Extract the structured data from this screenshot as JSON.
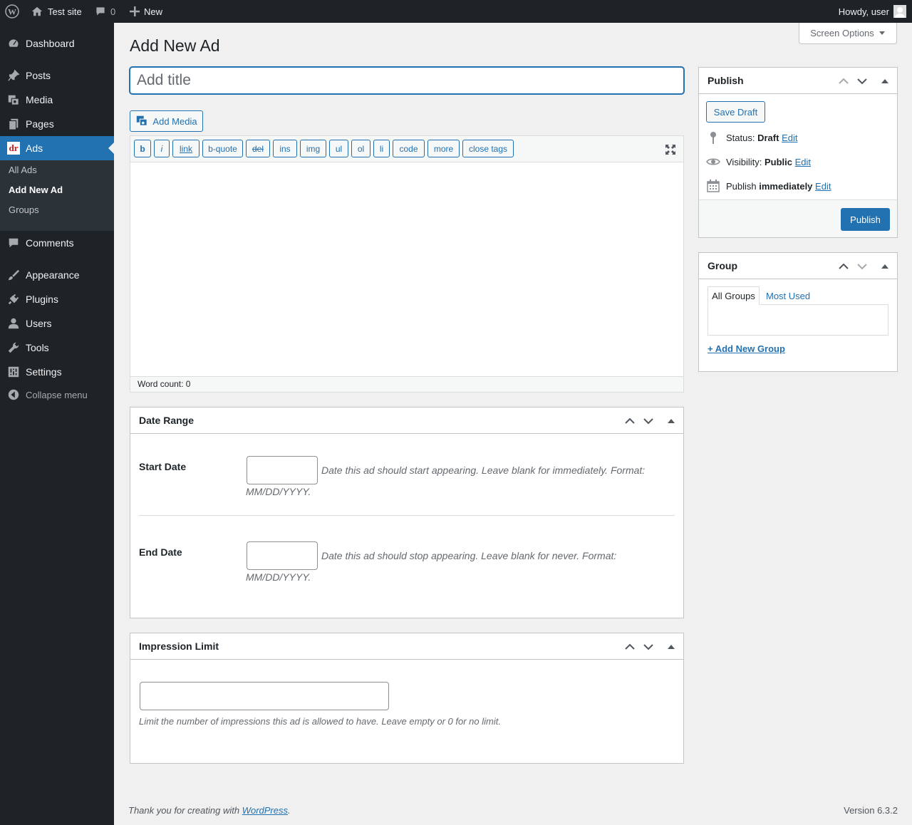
{
  "adminbar": {
    "site_name": "Test site",
    "comments_count": "0",
    "new_label": "New",
    "howdy": "Howdy, user"
  },
  "sidebar": {
    "items": [
      {
        "label": "Dashboard",
        "icon": "dashboard-icon"
      },
      {
        "label": "Posts",
        "icon": "pin-icon"
      },
      {
        "label": "Media",
        "icon": "media-icon"
      },
      {
        "label": "Pages",
        "icon": "pages-icon"
      },
      {
        "label": "Ads",
        "icon": "ads-logo-icon",
        "current": true
      },
      {
        "label": "Comments",
        "icon": "comment-icon"
      },
      {
        "label": "Appearance",
        "icon": "brush-icon"
      },
      {
        "label": "Plugins",
        "icon": "plug-icon"
      },
      {
        "label": "Users",
        "icon": "user-icon"
      },
      {
        "label": "Tools",
        "icon": "wrench-icon"
      },
      {
        "label": "Settings",
        "icon": "settings-icon"
      },
      {
        "label": "Collapse menu",
        "icon": "collapse-icon"
      }
    ],
    "submenu": [
      {
        "label": "All Ads"
      },
      {
        "label": "Add New Ad",
        "current": true
      },
      {
        "label": "Groups"
      }
    ],
    "ads_logo_text": "dr"
  },
  "page": {
    "title": "Add New Ad",
    "screen_options": "Screen Options",
    "title_placeholder": "Add title",
    "add_media": "Add Media"
  },
  "editor": {
    "quicktags": [
      "b",
      "i",
      "link",
      "b-quote",
      "del",
      "ins",
      "img",
      "ul",
      "ol",
      "li",
      "code",
      "more",
      "close tags"
    ],
    "word_count": "Word count: 0"
  },
  "date_range": {
    "title": "Date Range",
    "start_label": "Start Date",
    "start_value": "",
    "start_desc": "Date this ad should start appearing. Leave blank for immediately. Format: MM/DD/YYYY.",
    "end_label": "End Date",
    "end_value": "",
    "end_desc": "Date this ad should stop appearing. Leave blank for never. Format: MM/DD/YYYY."
  },
  "impression": {
    "title": "Impression Limit",
    "value": "",
    "desc": "Limit the number of impressions this ad is allowed to have. Leave empty or 0 for no limit."
  },
  "publish": {
    "title": "Publish",
    "save_draft": "Save Draft",
    "status_label": "Status:",
    "status_value": "Draft",
    "visibility_label": "Visibility:",
    "visibility_value": "Public",
    "publish_label": "Publish",
    "publish_value": "immediately",
    "edit": "Edit",
    "publish_button": "Publish"
  },
  "group": {
    "title": "Group",
    "tab_all": "All Groups",
    "tab_used": "Most Used",
    "add_new": "+ Add New Group"
  },
  "footer": {
    "thanks_prefix": "Thank you for creating with ",
    "wordpress_link": "WordPress",
    "thanks_suffix": ".",
    "version": "Version 6.3.2"
  },
  "colors": {
    "accent": "#2271b1",
    "adminbar": "#1d2327",
    "background": "#f0f0f1"
  }
}
